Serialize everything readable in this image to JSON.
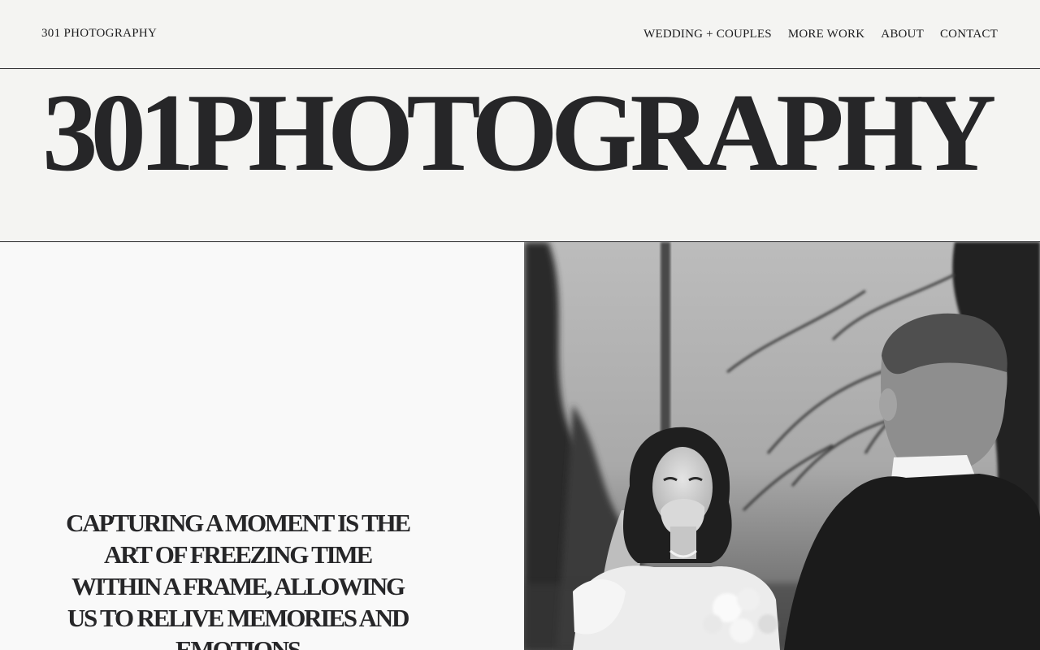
{
  "header": {
    "brand": "301 PHOTOGRAPHY",
    "nav": [
      {
        "label": "WEDDING + COUPLES"
      },
      {
        "label": "MORE WORK"
      },
      {
        "label": "ABOUT"
      },
      {
        "label": "CONTACT"
      }
    ]
  },
  "hero": {
    "title": "301PHOTOGRAPHY"
  },
  "intro": {
    "tagline": "CAPTURING A MOMENT IS THE ART OF FREEZING TIME WITHIN A FRAME, ALLOWING US TO RELIVE MEMORIES AND EMOTIONS"
  },
  "photo": {
    "subject": "black-and-white wedding photo of a laughing bride facing a groom outdoors"
  },
  "colors": {
    "background": "#f4f4f2",
    "text": "#262628",
    "panel": "#f9f9f9"
  }
}
